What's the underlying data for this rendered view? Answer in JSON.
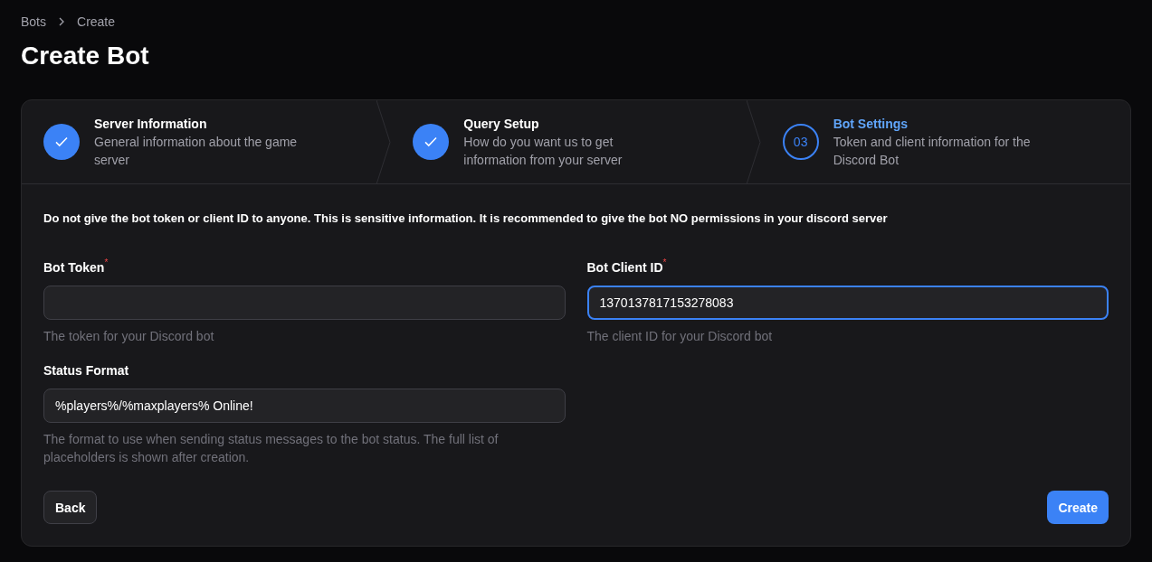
{
  "breadcrumb": [
    {
      "label": "Bots"
    },
    {
      "label": "Create"
    }
  ],
  "title": "Create Bot",
  "steps": [
    {
      "title": "Server Information",
      "description": "General information about the game server",
      "completed": true,
      "selected": false
    },
    {
      "title": "Query Setup",
      "description": "How do you want us to get information from your server",
      "completed": true,
      "selected": false
    },
    {
      "title": "Bot Settings",
      "description": "Token and client information for the Discord Bot",
      "completed": false,
      "selected": true,
      "number": "03"
    }
  ],
  "warning": "Do not give the bot token or client ID to anyone. This is sensitive information. It is recommended to give the bot NO permissions in your discord server",
  "fields": [
    {
      "label": "Bot Token",
      "required_mark": "*",
      "focused": false,
      "help": "The token for your Discord bot"
    },
    {
      "label": "Bot Client ID",
      "required_mark": "*",
      "value": "1370137817153278083",
      "focused": true,
      "help": "The client ID for your Discord bot"
    },
    {
      "label": "Status Format",
      "value": "%players%/%maxplayers% Online!",
      "focused": false,
      "help": "The format to use when sending status messages to the bot status. The full list of placeholders is shown after creation."
    }
  ],
  "buttons": [
    {
      "label": "Back",
      "kind": "secondary"
    },
    {
      "label": "Create",
      "kind": "primary"
    }
  ]
}
